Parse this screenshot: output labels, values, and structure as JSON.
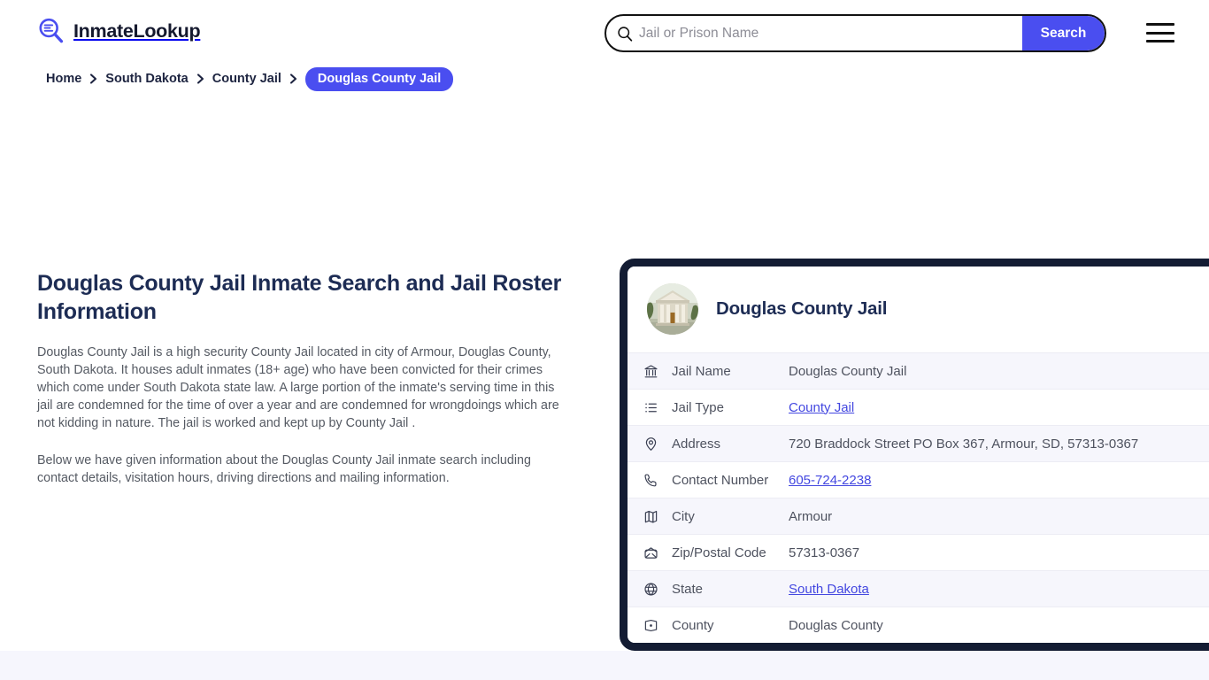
{
  "brand": {
    "name": "InmateLookup",
    "logo_icon": "magnifier-list-icon"
  },
  "search": {
    "placeholder": "Jail or Prison Name",
    "value": "",
    "button_label": "Search",
    "icon": "search-icon"
  },
  "menu": {
    "icon": "hamburger-menu-icon"
  },
  "breadcrumb": {
    "items": [
      {
        "label": "Home",
        "current": false
      },
      {
        "label": "South Dakota",
        "current": false
      },
      {
        "label": "County Jail",
        "current": false
      },
      {
        "label": "Douglas County Jail",
        "current": true
      }
    ]
  },
  "intro": {
    "title": "Douglas County Jail Inmate Search and Jail Roster Information",
    "paragraph_1": "Douglas County Jail is a high security County Jail located in city of Armour, Douglas County, South Dakota. It houses adult inmates (18+ age) who have been convicted for their crimes which come under South Dakota state law. A large portion of the inmate's serving time in this jail are condemned for the time of over a year and are condemned for wrongdoings which are not kidding in nature. The jail is worked and kept up by County Jail .",
    "paragraph_2": "Below we have given information about the Douglas County Jail inmate search including contact details, visitation hours, driving directions and mailing information."
  },
  "info_card": {
    "title": "Douglas County Jail",
    "thumbnail_icon": "courthouse-photo",
    "rows": [
      {
        "icon": "bank-icon",
        "label": "Jail Name",
        "value": "Douglas County Jail",
        "link": false
      },
      {
        "icon": "list-icon",
        "label": "Jail Type",
        "value": "County Jail",
        "link": true
      },
      {
        "icon": "map-pin-icon",
        "label": "Address",
        "value": "720 Braddock Street PO Box 367, Armour, SD, 57313-0367",
        "link": false
      },
      {
        "icon": "phone-icon",
        "label": "Contact Number",
        "value": "605-724-2238",
        "link": true
      },
      {
        "icon": "map-icon",
        "label": "City",
        "value": "Armour",
        "link": false
      },
      {
        "icon": "envelope-icon",
        "label": "Zip/Postal Code",
        "value": "57313-0367",
        "link": false
      },
      {
        "icon": "globe-icon",
        "label": "State",
        "value": "South Dakota",
        "link": true
      },
      {
        "icon": "region-icon",
        "label": "County",
        "value": "Douglas County",
        "link": false
      }
    ]
  },
  "colors": {
    "accent": "#4a4ef0",
    "card_border": "#131c33",
    "heading": "#1d2c54",
    "row_alt": "#f6f6fc",
    "footer_band": "#f6f6fd"
  }
}
